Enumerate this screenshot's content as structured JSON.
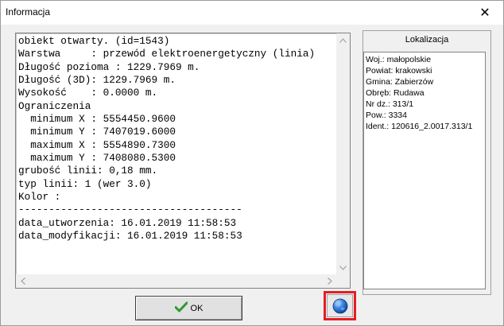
{
  "window": {
    "title": "Informacja",
    "close_glyph": "✕"
  },
  "info": {
    "lines": [
      "obiekt otwarty. (id=1543)",
      "Warstwa     : przewód elektroenergetyczny (linia)",
      "Długość pozioma : 1229.7969 m.",
      "Długość (3D): 1229.7969 m.",
      "Wysokość    : 0.0000 m.",
      "Ograniczenia",
      "  minimum X : 5554450.9600",
      "  minimum Y : 7407019.6000",
      "  maximum X : 5554890.7300",
      "  maximum Y : 7408080.5300",
      "grubość linii: 0,18 mm.",
      "typ linii: 1 (wer 3.0)",
      "Kolor :",
      "-------------------------------------",
      "data_utworzenia: 16.01.2019 11:58:53",
      "data_modyfikacji: 16.01.2019 11:58:53"
    ]
  },
  "localization": {
    "title": "Lokalizacja",
    "lines": [
      "Woj.: małopolskie",
      "Powiat: krakowski",
      "Gmina: Zabierzów",
      "Obręb: Rudawa",
      "Nr dz.: 313/1",
      "Pow.: 3334",
      "Ident.: 120616_2.0017.313/1"
    ]
  },
  "buttons": {
    "ok_label": "OK"
  },
  "icons": {
    "close": "close-icon",
    "ok": "checkmark-icon",
    "globe": "globe-icon",
    "scroll_up": "arrow-up-icon",
    "scroll_down": "arrow-down-icon",
    "scroll_left": "arrow-left-icon",
    "scroll_right": "arrow-right-icon"
  },
  "colors": {
    "highlight_frame": "#e31e24",
    "check_green": "#2e9b2e",
    "globe_blue": "#1e64c8"
  }
}
